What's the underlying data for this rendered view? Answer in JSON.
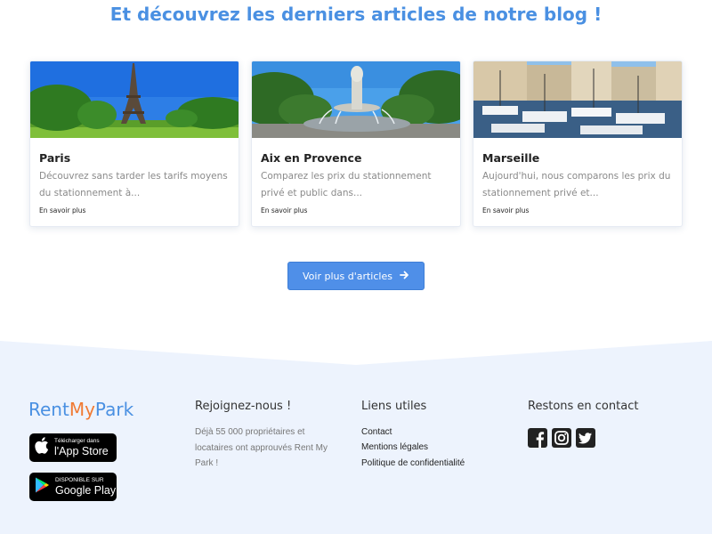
{
  "blog": {
    "title": "Et découvrez les derniers articles de notre blog !",
    "articles": [
      {
        "title": "Paris",
        "excerpt": "Découvrez sans tarder les tarifs moyens du stationnement à...",
        "more": "En savoir plus"
      },
      {
        "title": "Aix en Provence",
        "excerpt": "Comparez les prix du stationnement privé et public dans...",
        "more": "En savoir plus"
      },
      {
        "title": "Marseille",
        "excerpt": "Aujourd'hui, nous comparons les prix du stationnement privé et...",
        "more": "En savoir plus"
      }
    ],
    "more_button": "Voir plus d'articles"
  },
  "footer": {
    "logo_part1": "Rent",
    "logo_part2": "My",
    "logo_part3": "Park",
    "app_store": {
      "small": "Télécharger dans",
      "big": "l'App Store"
    },
    "google_play": {
      "small": "DISPONIBLE SUR",
      "big": "Google Play"
    },
    "join": {
      "title": "Rejoignez-nous !",
      "text": "Déjà 55 000 propriétaires et locataires ont approuvés Rent My Park !"
    },
    "links": {
      "title": "Liens utiles",
      "items": [
        "Contact",
        "Mentions légales",
        "Politique de confidentialité"
      ]
    },
    "contact": {
      "title": "Restons en contact",
      "icons": [
        "facebook-icon",
        "instagram-icon",
        "twitter-icon"
      ]
    }
  },
  "colors": {
    "accent": "#4a90e2",
    "brand_orange": "#f07a33",
    "footer_bg": "#edf3fd",
    "button": "#4f8fe8"
  }
}
